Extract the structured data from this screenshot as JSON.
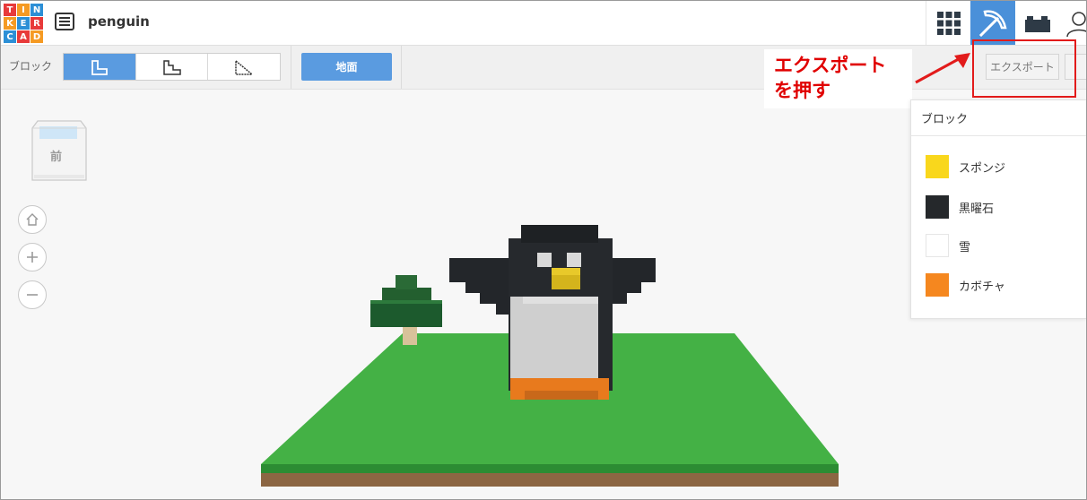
{
  "app": {
    "logo_letters": [
      "T",
      "I",
      "N",
      "K",
      "E",
      "R",
      "C",
      "A",
      "D"
    ],
    "logo_colors": [
      "#e83a3a",
      "#f59a23",
      "#2c8fd6",
      "#f59a23",
      "#2c8fd6",
      "#e83a3a",
      "#2c8fd6",
      "#e83a3a",
      "#f59a23"
    ],
    "project_name": "penguin"
  },
  "topbar": {
    "buttons": [
      {
        "name": "grid-icon",
        "active": false
      },
      {
        "name": "pickaxe-icon",
        "active": true
      },
      {
        "name": "brick-icon",
        "active": false
      },
      {
        "name": "user-icon",
        "active": false
      }
    ],
    "accent": "#4a90d9"
  },
  "toolbar": {
    "block_label": "ブロック",
    "shape_buttons": [
      {
        "name": "l-block-icon",
        "active": true
      },
      {
        "name": "stair-block-icon",
        "active": false
      },
      {
        "name": "slope-block-icon",
        "active": false
      }
    ],
    "ground_label": "地面",
    "export_label": "エクスポート"
  },
  "annotation": {
    "line1": "エクスポート",
    "line2": "を押す",
    "color": "#e00000"
  },
  "viewcube": {
    "face_label": "前"
  },
  "nav": [
    {
      "name": "home-icon"
    },
    {
      "name": "zoom-in-icon"
    },
    {
      "name": "zoom-out-icon"
    }
  ],
  "panel": {
    "title": "ブロック",
    "items": [
      {
        "label": "スポンジ",
        "color": "#f9d71c"
      },
      {
        "label": "黒曜石",
        "color": "#25282b"
      },
      {
        "label": "雪",
        "color": "#ffffff"
      },
      {
        "label": "カボチャ",
        "color": "#f5871f"
      }
    ]
  }
}
